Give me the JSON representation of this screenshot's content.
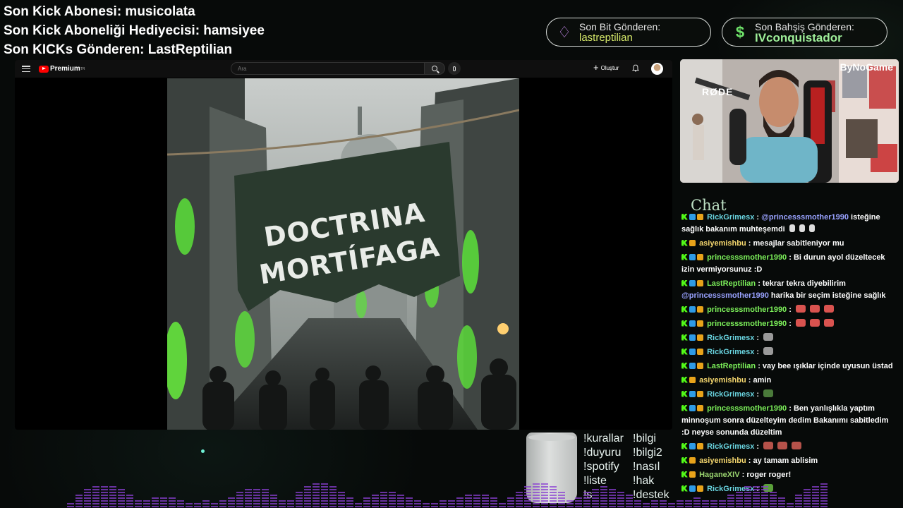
{
  "overlay": {
    "last_sub": "Son Kick Abonesi: musicolata",
    "last_gifter": "Son Kick Aboneliği Hediyecisi: hamsiyee",
    "last_kicks": "Son KICKs Gönderen: LastReptilian",
    "bits_badge": {
      "title": "Son Bit Gönderen:",
      "value": "lastreptilian",
      "icon": "diamond-icon"
    },
    "bet_badge": {
      "title": "Son Bahşiş Gönderen:",
      "value": "IVconquistador",
      "icon": "dollar-icon"
    }
  },
  "youtube": {
    "brand": "Premium",
    "tm": "TR",
    "search_placeholder": "Ara",
    "create_label": "Oluştur"
  },
  "video": {
    "banner_line1": "DOCTRINA",
    "banner_line2": "MORTÍFAGA"
  },
  "webcam": {
    "watermark": "ByNoGame",
    "mic_brand": "RØDE"
  },
  "chat": {
    "title": "Chat",
    "messages": [
      {
        "user": "RickGrimesx",
        "cls": "b",
        "mention": "@princesssmother1990",
        "text": "isteğine sağlık bakanım muhteşemdi"
      },
      {
        "user": "asiyemishbu",
        "cls": "a",
        "text": "mesajlar sabitleniyor mu"
      },
      {
        "user": "princesssmother1990",
        "cls": "",
        "text": "Bi durun ayol düzeltecek izin vermiyorsunuz :D"
      },
      {
        "user": "LastReptilian",
        "cls": "",
        "text": "tekrar tekra diyebilirim",
        "mention2": "@princesssmother1990",
        "text2": "harika bir seçim isteğine sağlık"
      },
      {
        "user": "princesssmother1990",
        "cls": "",
        "text": ""
      },
      {
        "user": "princesssmother1990",
        "cls": "",
        "text": ""
      },
      {
        "user": "RickGrimesx",
        "cls": "b",
        "text": ""
      },
      {
        "user": "RickGrimesx",
        "cls": "b",
        "text": ""
      },
      {
        "user": "LastReptilian",
        "cls": "",
        "text": "vay bee ışıklar içinde uyusun üstad"
      },
      {
        "user": "asiyemishbu",
        "cls": "a",
        "text": "amin"
      },
      {
        "user": "RickGrimesx",
        "cls": "b",
        "text": ""
      },
      {
        "user": "princesssmother1990",
        "cls": "",
        "text": "Ben yanlışlıkla yaptım minnoşum sonra düzelteyim dedim Bakanımı sabitledim :D neyse sonunda düzeltim"
      },
      {
        "user": "RickGrimesx",
        "cls": "b",
        "text": ""
      },
      {
        "user": "asiyemishbu",
        "cls": "a",
        "text": "ay tamam ablisim"
      },
      {
        "user": "HaganeXIV",
        "cls": "c",
        "text": "roger roger!"
      },
      {
        "user": "RickGrimesx",
        "cls": "b",
        "text": ""
      }
    ]
  },
  "commands": [
    "!kurallar",
    "!bilgi",
    "!duyuru",
    "!bilgi2",
    "!spotify",
    "!nasıl",
    "!liste",
    "!hak",
    "!s",
    "!destek"
  ],
  "colors": {
    "accent": "#d5e86a",
    "chat_title": "#bde0c4",
    "eq": "#8a3fd1"
  }
}
